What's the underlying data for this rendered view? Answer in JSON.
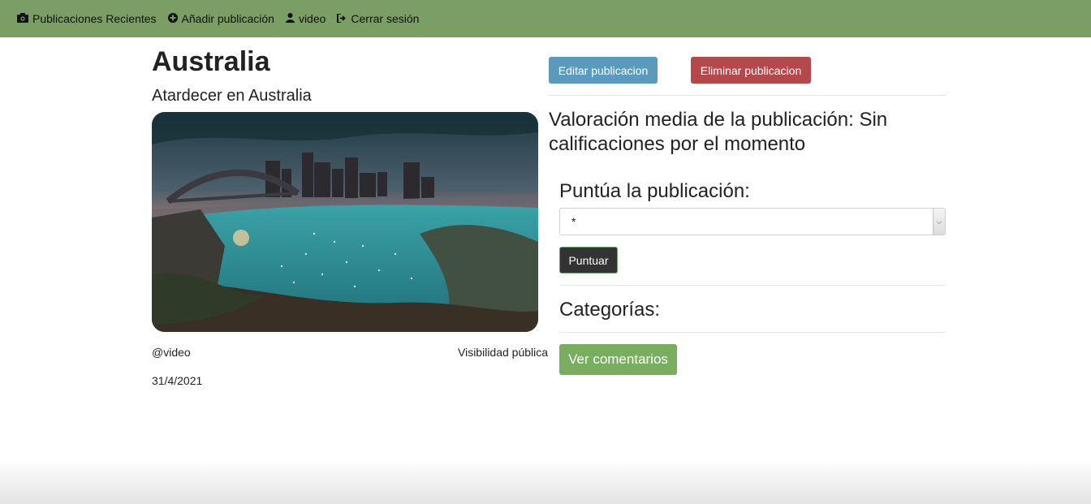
{
  "nav": {
    "items": [
      {
        "label": "Publicaciones Recientes",
        "icon": "camera-icon"
      },
      {
        "label": "Añadir publicación",
        "icon": "plus-circle-icon"
      },
      {
        "label": "video",
        "icon": "user-icon"
      },
      {
        "label": "Cerrar sesión",
        "icon": "sign-out-icon"
      }
    ]
  },
  "post": {
    "title": "Australia",
    "subtitle": "Atardecer en Australia",
    "image_alt": "Sydney harbour at sunset",
    "username": "@video",
    "visibility": "Visibilidad pública",
    "date": "31/4/2021"
  },
  "actions": {
    "edit_label": "Editar publicacion",
    "delete_label": "Eliminar publicacion"
  },
  "rating": {
    "average_text": "Valoración media de la publicación: Sin calificaciones por el momento",
    "rate_label": "Puntúa la publicación:",
    "select_value": "*",
    "submit_label": "Puntuar"
  },
  "categories": {
    "heading": "Categorías:"
  },
  "comments": {
    "button_label": "Ver comentarios"
  },
  "colors": {
    "navbar": "#7b9e65",
    "edit_button": "#5a9bbd",
    "delete_button": "#b5484b",
    "rate_button": "#333333",
    "comments_button": "#79ae61"
  }
}
